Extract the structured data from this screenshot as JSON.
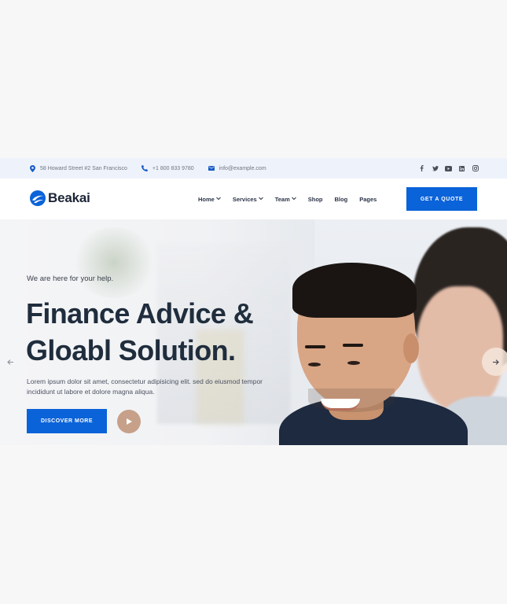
{
  "topbar": {
    "address": "58 Howard Street #2 San Francisco",
    "phone": "+1 800 833 9780",
    "email": "info@example.com",
    "socials": [
      "facebook-icon",
      "twitter-icon",
      "youtube-icon",
      "linkedin-icon",
      "instagram-icon"
    ]
  },
  "header": {
    "logo_text": "Beakai",
    "nav": [
      {
        "label": "Home",
        "dropdown": true
      },
      {
        "label": "Services",
        "dropdown": true
      },
      {
        "label": "Team",
        "dropdown": true
      },
      {
        "label": "Shop",
        "dropdown": false
      },
      {
        "label": "Blog",
        "dropdown": false
      },
      {
        "label": "Pages",
        "dropdown": false
      }
    ],
    "cta_label": "GET A QUOTE"
  },
  "hero": {
    "subtitle": "We are here for your help.",
    "title_line1": "Finance Advice &",
    "title_line2": "Gloabl Solution.",
    "description_line1": "Lorem ipsum dolor sit amet, consectetur adipisicing elit. sed do eiusmod tempor",
    "description_line2": "incididunt ut labore et dolore magna aliqua.",
    "button_label": "DISCOVER MORE"
  },
  "colors": {
    "accent": "#0b63d9",
    "heading": "#1f2d3d",
    "play_button": "#c6a088"
  }
}
